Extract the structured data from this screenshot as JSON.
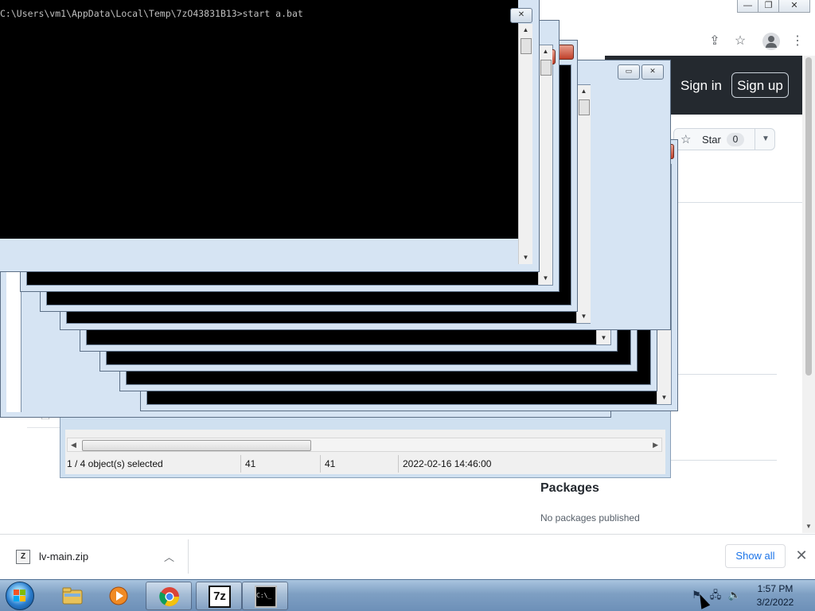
{
  "console": {
    "prompt_line": "C:\\Users\\vm1\\AppData\\Local\\Temp\\7zO43831B13>start a.bat"
  },
  "browser": {
    "window_controls": {
      "minimize": "—",
      "maximize": "❐",
      "close": "✕"
    },
    "github": {
      "sign_in": "Sign in",
      "sign_up": "Sign up",
      "star_label": "Star",
      "star_count": "0",
      "packages_title": "Packages",
      "packages_note": "No packages published"
    }
  },
  "sevenzip": {
    "status": {
      "selection": "1 / 4 object(s) selected",
      "size": "41",
      "packed": "41",
      "modified": "2022-02-16 14:46:00"
    }
  },
  "download_bar": {
    "file_name": "lv-main.zip",
    "file_icon_text": "Z",
    "show_all": "Show all"
  },
  "taskbar": {
    "time": "1:57 PM",
    "date": "3/2/2022",
    "sevenzip_icon_text": "7z",
    "cmd_icon_text": "C:\\_"
  },
  "colors": {
    "github_header": "#24292f",
    "taskbar": "#7e9fc3",
    "console_frame": "#d6e4f3",
    "link_blue": "#1a73e8"
  }
}
